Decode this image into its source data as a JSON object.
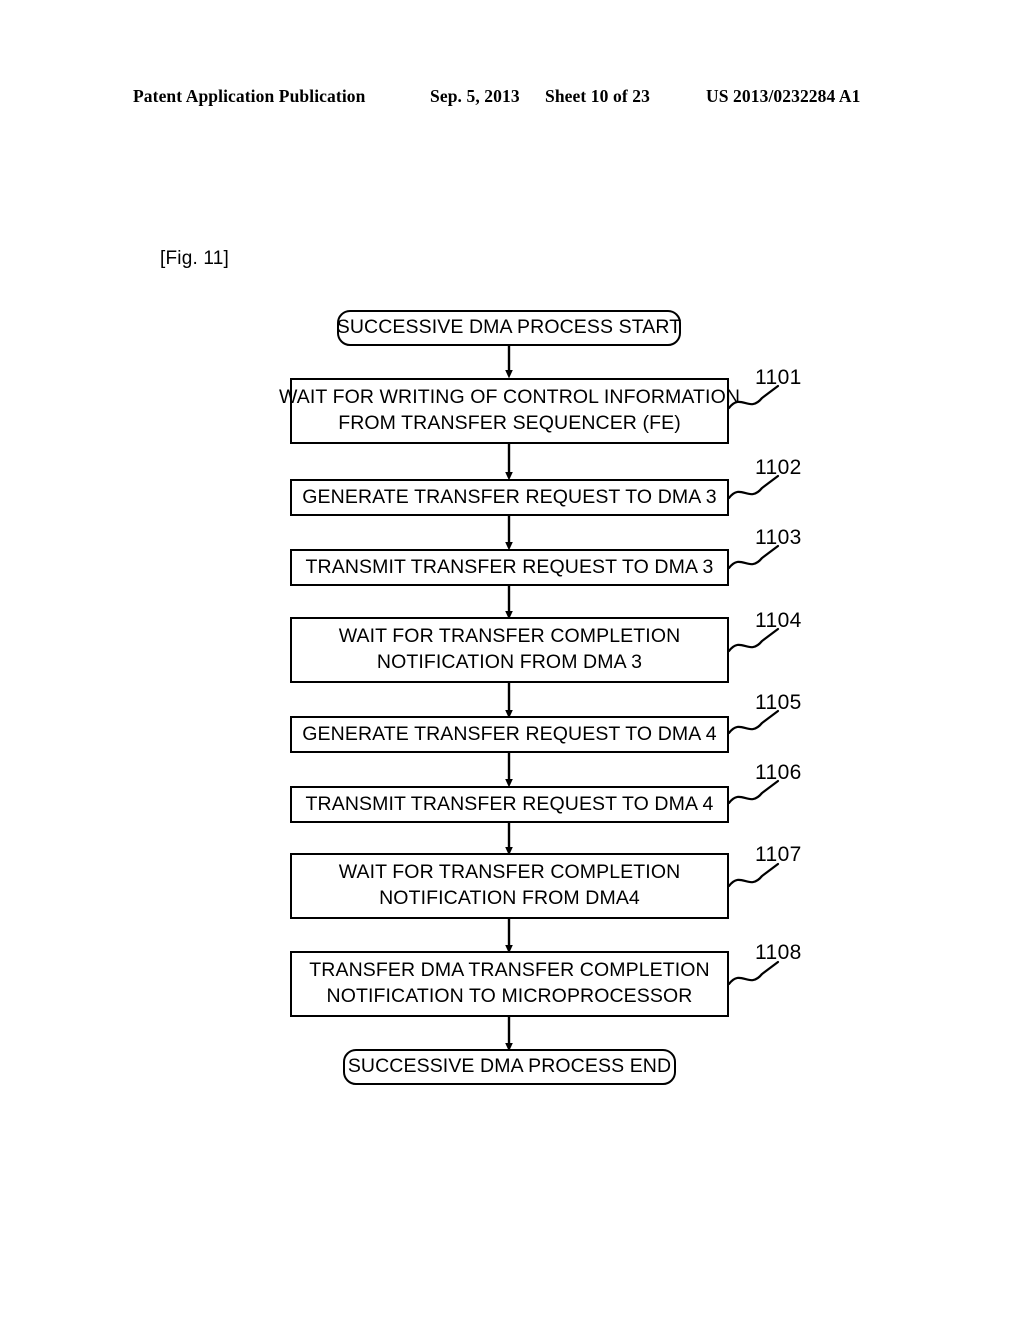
{
  "header": {
    "publication": "Patent Application Publication",
    "date": "Sep. 5, 2013",
    "sheet": "Sheet 10 of 23",
    "doc_id": "US 2013/0232284 A1"
  },
  "figure": {
    "label": "[Fig. 11]"
  },
  "colors": {
    "ink": "#000000",
    "page": "#ffffff"
  },
  "flowchart": {
    "title": "SUCCESSIVE DMA PROCESS",
    "nodes": [
      {
        "id": "start",
        "shape": "terminator",
        "line1": "SUCCESSIVE DMA PROCESS START",
        "line2": "",
        "ref": ""
      },
      {
        "id": "s1101",
        "shape": "process",
        "line1": "WAIT FOR WRITING OF CONTROL INFORMATION",
        "line2": "FROM TRANSFER SEQUENCER (FE)",
        "ref": "1101"
      },
      {
        "id": "s1102",
        "shape": "process",
        "line1": "GENERATE TRANSFER REQUEST TO DMA 3",
        "line2": "",
        "ref": "1102"
      },
      {
        "id": "s1103",
        "shape": "process",
        "line1": "TRANSMIT TRANSFER REQUEST TO DMA 3",
        "line2": "",
        "ref": "1103"
      },
      {
        "id": "s1104",
        "shape": "process",
        "line1": "WAIT FOR TRANSFER COMPLETION",
        "line2": "NOTIFICATION FROM DMA 3",
        "ref": "1104"
      },
      {
        "id": "s1105",
        "shape": "process",
        "line1": "GENERATE TRANSFER REQUEST TO DMA 4",
        "line2": "",
        "ref": "1105"
      },
      {
        "id": "s1106",
        "shape": "process",
        "line1": "TRANSMIT TRANSFER REQUEST TO DMA 4",
        "line2": "",
        "ref": "1106"
      },
      {
        "id": "s1107",
        "shape": "process",
        "line1": "WAIT FOR TRANSFER COMPLETION",
        "line2": "NOTIFICATION FROM DMA4",
        "ref": "1107"
      },
      {
        "id": "s1108",
        "shape": "process",
        "line1": "TRANSFER DMA TRANSFER COMPLETION",
        "line2": "NOTIFICATION TO MICROPROCESSOR",
        "ref": "1108"
      },
      {
        "id": "end",
        "shape": "terminator",
        "line1": "SUCCESSIVE DMA PROCESS END",
        "line2": "",
        "ref": ""
      }
    ]
  }
}
